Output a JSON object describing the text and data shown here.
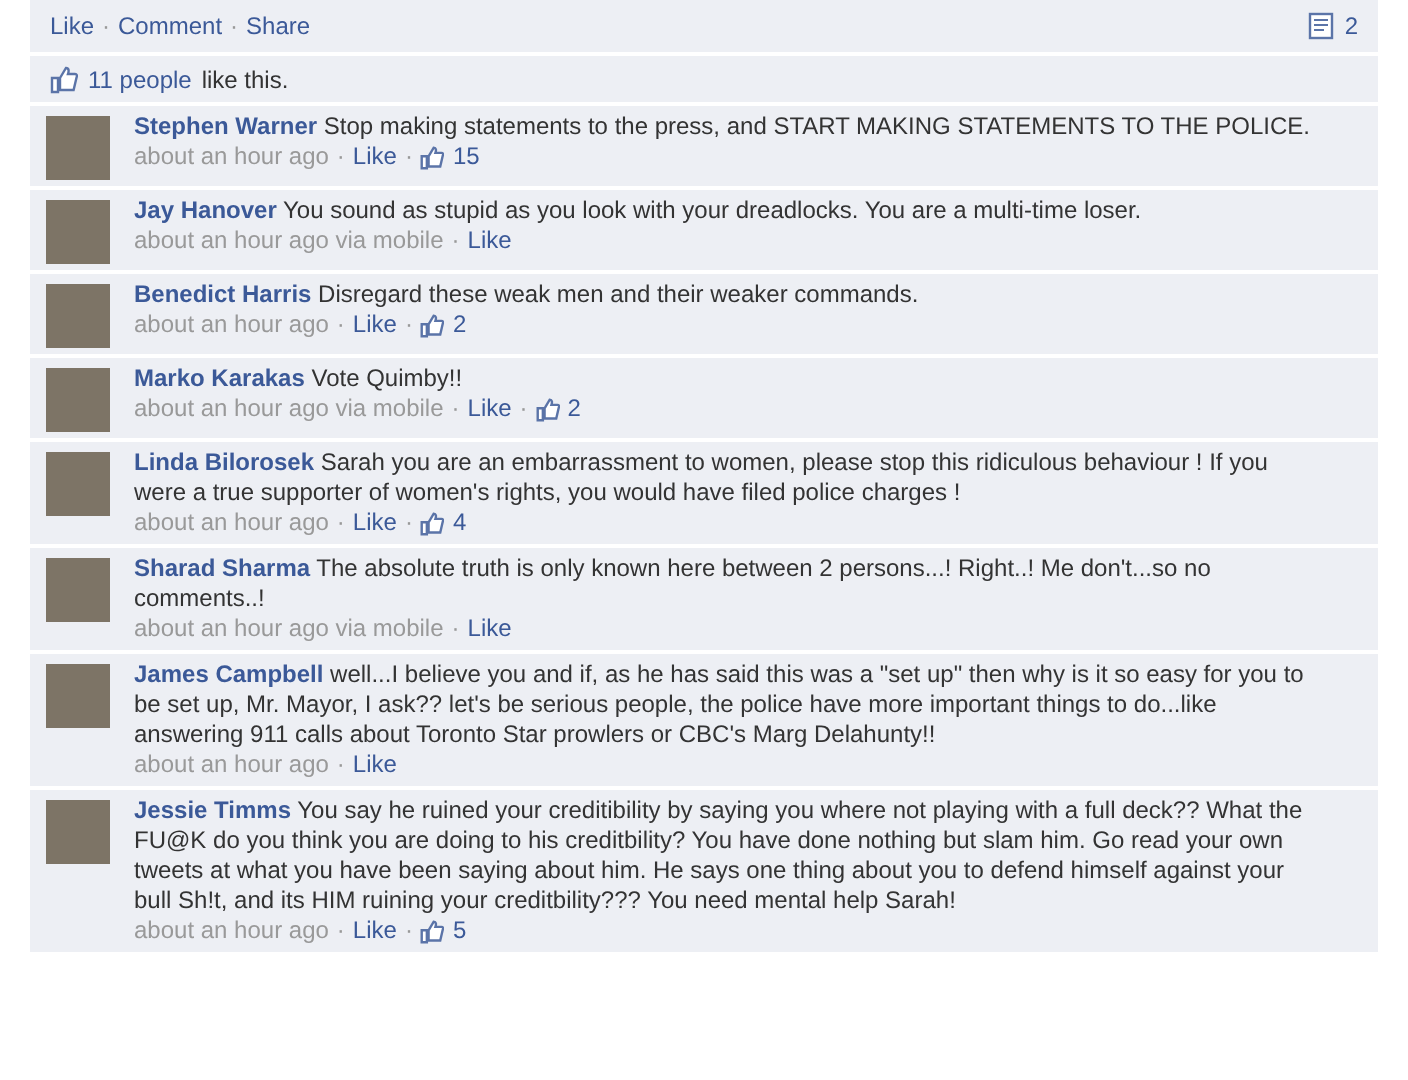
{
  "separator": "·",
  "actions": {
    "links": [
      "Like",
      "Comment",
      "Share"
    ],
    "comment_count": "2"
  },
  "likes": {
    "count_link": "11 people",
    "text": "like this."
  },
  "comments": [
    {
      "name": "Stephen Warner",
      "text": "Stop making statements to the press, and START MAKING STATEMENTS TO THE POLICE.",
      "time": "about an hour ago",
      "like": "Like",
      "likes": "15"
    },
    {
      "name": "Jay Hanover",
      "text": "You sound as stupid as you look with your dreadlocks. You are a multi-time loser.",
      "time": "about an hour ago via mobile",
      "like": "Like"
    },
    {
      "name": "Benedict Harris",
      "text": "Disregard these weak men and their weaker commands.",
      "time": "about an hour ago",
      "like": "Like",
      "likes": "2"
    },
    {
      "name": "Marko Karakas",
      "text": "Vote Quimby!!",
      "time": "about an hour ago via mobile",
      "like": "Like",
      "likes": "2"
    },
    {
      "name": "Linda Bilorosek",
      "text": "Sarah you are an embarrassment to women, please stop this ridiculous behaviour ! If you were a true supporter of women's rights, you would have filed police charges !",
      "time": "about an hour ago",
      "like": "Like",
      "likes": "4"
    },
    {
      "name": "Sharad Sharma",
      "text": "The absolute truth is only known here between 2 persons...! Right..! Me don't...so no comments..!",
      "time": "about an hour ago via mobile",
      "like": "Like"
    },
    {
      "name": "James Campbell",
      "text": "well...I believe you and if, as he has said this was a \"set up\" then why is it so easy for you to be set up, Mr. Mayor, I ask?? let's be serious people, the police have more important things to do...like answering 911 calls about Toronto Star prowlers or CBC's Marg Delahunty!!",
      "time": "about an hour ago",
      "like": "Like"
    },
    {
      "name": "Jessie Timms",
      "text": "You say he ruined your creditibility by saying you where not playing with a full deck?? What the FU@K do you think you are doing to his creditbility? You have done nothing but slam him. Go read your own tweets at what you have been saying about him. He says one thing about you to defend himself against your bull Sh!t, and its HIM ruining your creditbility??? You need mental help Sarah!",
      "time": "about an hour ago",
      "like": "Like",
      "likes": "5"
    }
  ]
}
